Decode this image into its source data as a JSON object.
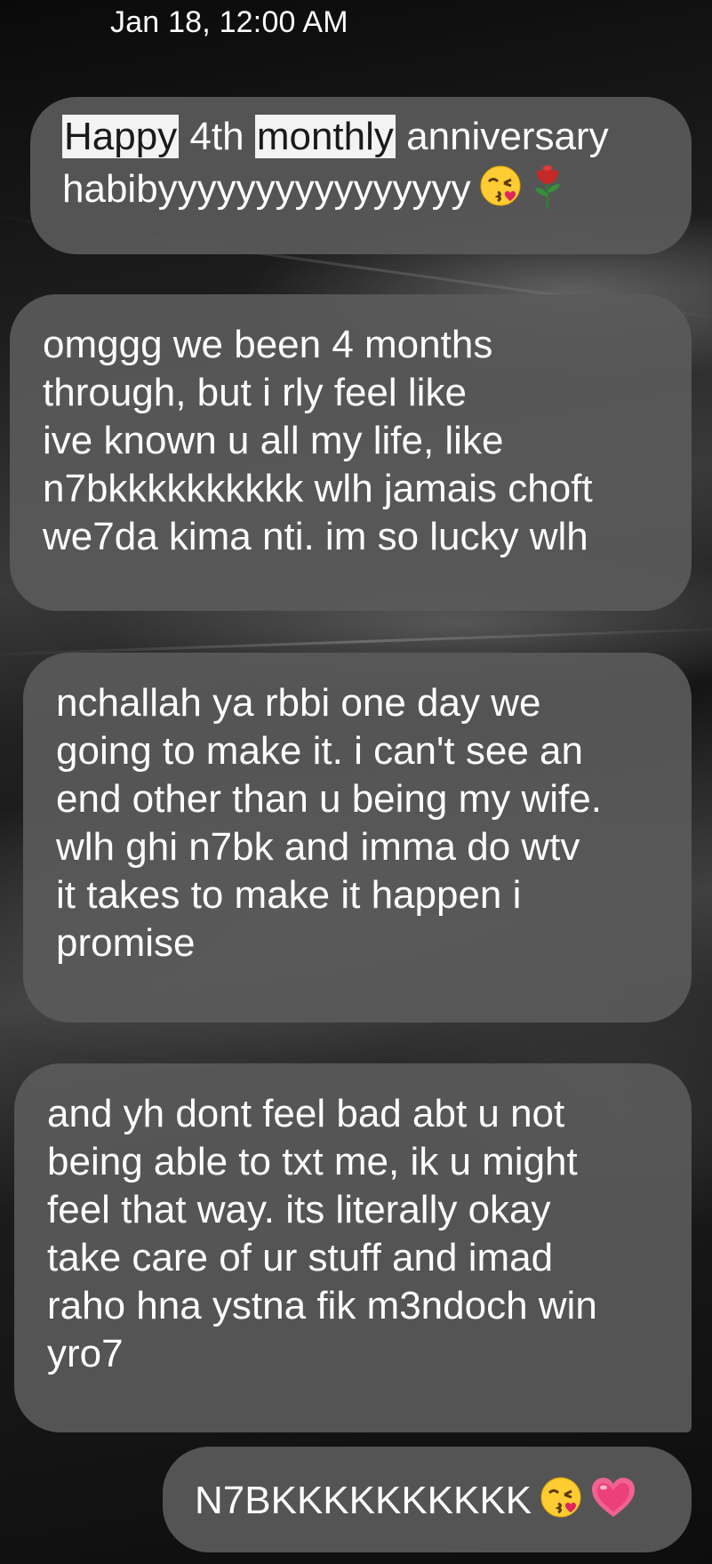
{
  "header": {
    "timestamp": "Jan 18, 12:00 AM"
  },
  "messages": [
    {
      "word1": "Happy",
      "word2": "4th",
      "word3": "monthly",
      "word4": "anniversary",
      "line2": "habibyyyyyyyyyyyyyyyy",
      "emojis": [
        "kissing-face-emoji",
        "rose-emoji"
      ]
    },
    {
      "lines": [
        "omggg we been 4 months",
        "through, but i rly feel like",
        "ive known u all my life, like",
        "n7bkkkkkkkkkk wlh jamais choft",
        "we7da kima nti. im so lucky wlh"
      ]
    },
    {
      "lines": [
        "nchallah ya rbbi one day we",
        "going to make it. i can't see an",
        "end other than u being my wife.",
        "wlh ghi n7bk and imma do wtv",
        "it takes to make it happen i",
        "promise"
      ]
    },
    {
      "lines": [
        "and yh dont feel bad abt u not",
        "being able to txt me, ik u might",
        "feel that way. its literally okay",
        "take care of ur stuff and imad",
        "raho hna ystna fik m3ndoch win",
        "yro7"
      ]
    },
    {
      "text": "N7BKKKKKKKKKK",
      "emojis": [
        "kissing-face-emoji",
        "pink-heart-emoji"
      ]
    }
  ],
  "colors": {
    "bubble": "#5a5a5a",
    "highlight": "#f3f3f3",
    "text": "#ffffff"
  }
}
